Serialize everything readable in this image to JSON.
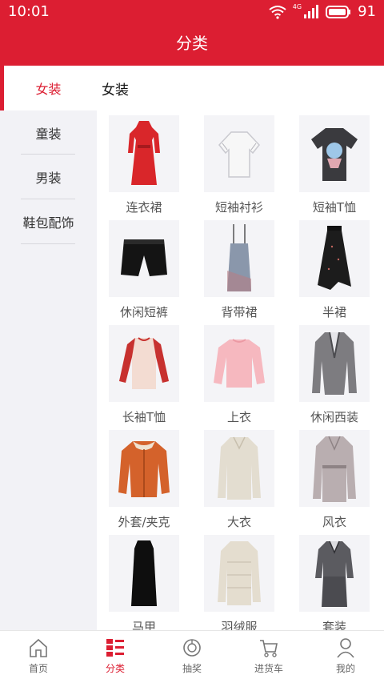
{
  "status_bar": {
    "time": "10:01",
    "battery": "91",
    "network": "4G"
  },
  "header": {
    "title": "分类"
  },
  "sidebar": {
    "items": [
      {
        "label": "女装",
        "active": true
      },
      {
        "label": "童装",
        "active": false
      },
      {
        "label": "男装",
        "active": false
      },
      {
        "label": "鞋包配饰",
        "active": false
      }
    ]
  },
  "main": {
    "section_title": "女装",
    "items": [
      {
        "label": "连衣裙",
        "icon": "red-dress-icon"
      },
      {
        "label": "短袖衬衫",
        "icon": "white-blouse-icon"
      },
      {
        "label": "短袖T恤",
        "icon": "graphic-tshirt-icon"
      },
      {
        "label": "休闲短裤",
        "icon": "black-shorts-icon"
      },
      {
        "label": "背带裙",
        "icon": "strap-dress-icon"
      },
      {
        "label": "半裙",
        "icon": "skirt-icon"
      },
      {
        "label": "长袖T恤",
        "icon": "longsleeve-tee-icon"
      },
      {
        "label": "上衣",
        "icon": "pink-sweater-icon"
      },
      {
        "label": "休闲西装",
        "icon": "blazer-icon"
      },
      {
        "label": "外套/夹克",
        "icon": "jacket-icon"
      },
      {
        "label": "大衣",
        "icon": "coat-icon"
      },
      {
        "label": "风衣",
        "icon": "trench-coat-icon"
      },
      {
        "label": "马甲",
        "icon": "vest-icon"
      },
      {
        "label": "羽绒服",
        "icon": "down-jacket-icon"
      },
      {
        "label": "套装",
        "icon": "suit-icon"
      }
    ]
  },
  "tabbar": {
    "items": [
      {
        "label": "首页",
        "icon": "home-icon",
        "active": false
      },
      {
        "label": "分类",
        "icon": "category-icon",
        "active": true
      },
      {
        "label": "抽奖",
        "icon": "lottery-icon",
        "active": false
      },
      {
        "label": "进货车",
        "icon": "cart-icon",
        "active": false
      },
      {
        "label": "我的",
        "icon": "profile-icon",
        "active": false
      }
    ]
  },
  "colors": {
    "accent": "#dc1e32",
    "sidebar_bg": "#f2f2f6",
    "thumb_bg": "#f4f4f7"
  }
}
